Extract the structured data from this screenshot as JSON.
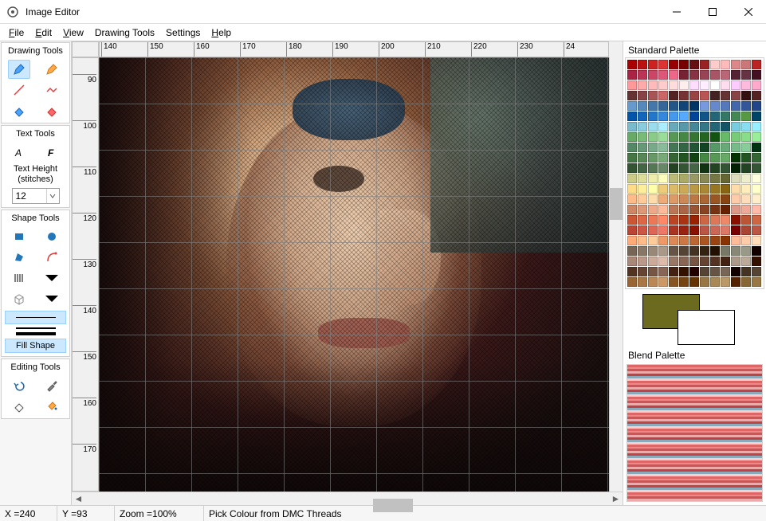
{
  "window": {
    "title": "Image Editor"
  },
  "menu": {
    "file": "File",
    "edit": "Edit",
    "view": "View",
    "drawing_tools": "Drawing Tools",
    "settings": "Settings",
    "help": "Help"
  },
  "toolbox": {
    "drawing_title": "Drawing Tools",
    "text_title": "Text Tools",
    "text_height_label": "Text Height (stitches)",
    "text_height_value": "12",
    "shape_title": "Shape Tools",
    "fill_shape": "Fill Shape",
    "editing_title": "Editing Tools"
  },
  "ruler_h": [
    "140",
    "150",
    "160",
    "170",
    "180",
    "190",
    "200",
    "210",
    "220",
    "230",
    "24"
  ],
  "ruler_v": [
    "90",
    "100",
    "110",
    "120",
    "130",
    "140",
    "150",
    "160",
    "170"
  ],
  "palette": {
    "standard_title": "Standard Palette",
    "blend_title": "Blend Palette",
    "selected_color": "#6b6a1e",
    "swatches": [
      "#a00",
      "#b11",
      "#c22",
      "#d33",
      "#900",
      "#700",
      "#611",
      "#922",
      "#fcc",
      "#fbb",
      "#d88",
      "#c77",
      "#b22",
      "#aa2244",
      "#bb3355",
      "#cc4466",
      "#dd5577",
      "#ee6688",
      "#772233",
      "#883344",
      "#994455",
      "#aa5566",
      "#bb6677",
      "#552233",
      "#663344",
      "#441122",
      "#f99",
      "#faa",
      "#fbb",
      "#fcc",
      "#fdd",
      "#fee",
      "#fdf",
      "#fef",
      "#fff",
      "#fde",
      "#fcf",
      "#fbd",
      "#fac",
      "#633",
      "#844",
      "#a55",
      "#c66",
      "#522",
      "#733",
      "#944",
      "#b55",
      "#422",
      "#633",
      "#844",
      "#311",
      "#522",
      "#69c",
      "#58b",
      "#47a",
      "#369",
      "#258",
      "#147",
      "#036",
      "#79d",
      "#68c",
      "#57b",
      "#46a",
      "#359",
      "#248",
      "#05a",
      "#16b",
      "#27c",
      "#38d",
      "#49e",
      "#5af",
      "#049",
      "#158",
      "#267",
      "#376",
      "#485",
      "#594",
      "#046",
      "#7bc",
      "#8cd",
      "#9de",
      "#aef",
      "#6ab",
      "#59a",
      "#489",
      "#378",
      "#267",
      "#156",
      "#7cd",
      "#8de",
      "#9ef",
      "#6a6",
      "#7b7",
      "#8c8",
      "#9d9",
      "#595",
      "#484",
      "#373",
      "#262",
      "#151",
      "#6b6",
      "#7c7",
      "#8d8",
      "#9e9",
      "#586",
      "#697",
      "#7a8",
      "#8b9",
      "#475",
      "#364",
      "#253",
      "#142",
      "#596",
      "#6a7",
      "#7b8",
      "#8c9",
      "#031",
      "#474",
      "#585",
      "#696",
      "#7a7",
      "#363",
      "#252",
      "#141",
      "#484",
      "#595",
      "#6a6",
      "#030",
      "#252",
      "#363",
      "#353",
      "#464",
      "#575",
      "#686",
      "#242",
      "#353",
      "#464",
      "#131",
      "#242",
      "#353",
      "#020",
      "#242",
      "#353",
      "#cc8",
      "#dd9",
      "#eea",
      "#ffb",
      "#bb7",
      "#aa6",
      "#996",
      "#885",
      "#774",
      "#663",
      "#ddb",
      "#eec",
      "#ffd",
      "#fd8",
      "#fe9",
      "#ffa",
      "#ec7",
      "#db6",
      "#ca5",
      "#b94",
      "#a83",
      "#972",
      "#861",
      "#fda",
      "#feb",
      "#ffc",
      "#fb8",
      "#fc9",
      "#fda",
      "#ea7",
      "#d96",
      "#c85",
      "#b74",
      "#a63",
      "#952",
      "#841",
      "#fca",
      "#fdb",
      "#fec",
      "#c86",
      "#d97",
      "#ea8",
      "#fb9",
      "#b75",
      "#a64",
      "#953",
      "#842",
      "#731",
      "#620",
      "#d98",
      "#ea9",
      "#fba",
      "#c53",
      "#d64",
      "#e75",
      "#f86",
      "#b42",
      "#a31",
      "#920",
      "#c64",
      "#d75",
      "#e86",
      "#810",
      "#b53",
      "#c64",
      "#b43",
      "#c54",
      "#d65",
      "#e76",
      "#a32",
      "#921",
      "#810",
      "#b54",
      "#c65",
      "#d76",
      "#700",
      "#a43",
      "#b54",
      "#fa7",
      "#fb8",
      "#fc9",
      "#e96",
      "#d85",
      "#c74",
      "#b63",
      "#a52",
      "#941",
      "#830",
      "#fb9",
      "#fca",
      "#fdb",
      "#765",
      "#876",
      "#987",
      "#a98",
      "#654",
      "#543",
      "#432",
      "#321",
      "#210",
      "#776",
      "#887",
      "#998",
      "#100",
      "#a87",
      "#b98",
      "#ca9",
      "#dba",
      "#976",
      "#865",
      "#754",
      "#643",
      "#532",
      "#421",
      "#a98",
      "#ba9",
      "#310",
      "#532",
      "#643",
      "#754",
      "#865",
      "#421",
      "#310",
      "#200",
      "#543",
      "#654",
      "#765",
      "#100",
      "#432",
      "#543",
      "#963",
      "#a74",
      "#b85",
      "#c96",
      "#852",
      "#741",
      "#630",
      "#974",
      "#a85",
      "#b96",
      "#520",
      "#863",
      "#974"
    ]
  },
  "status": {
    "x_label": "X = ",
    "x_value": "240",
    "y_label": "Y = ",
    "y_value": "93",
    "zoom_label": "Zoom = ",
    "zoom_value": "100%",
    "hint": "Pick Colour from DMC Threads"
  }
}
